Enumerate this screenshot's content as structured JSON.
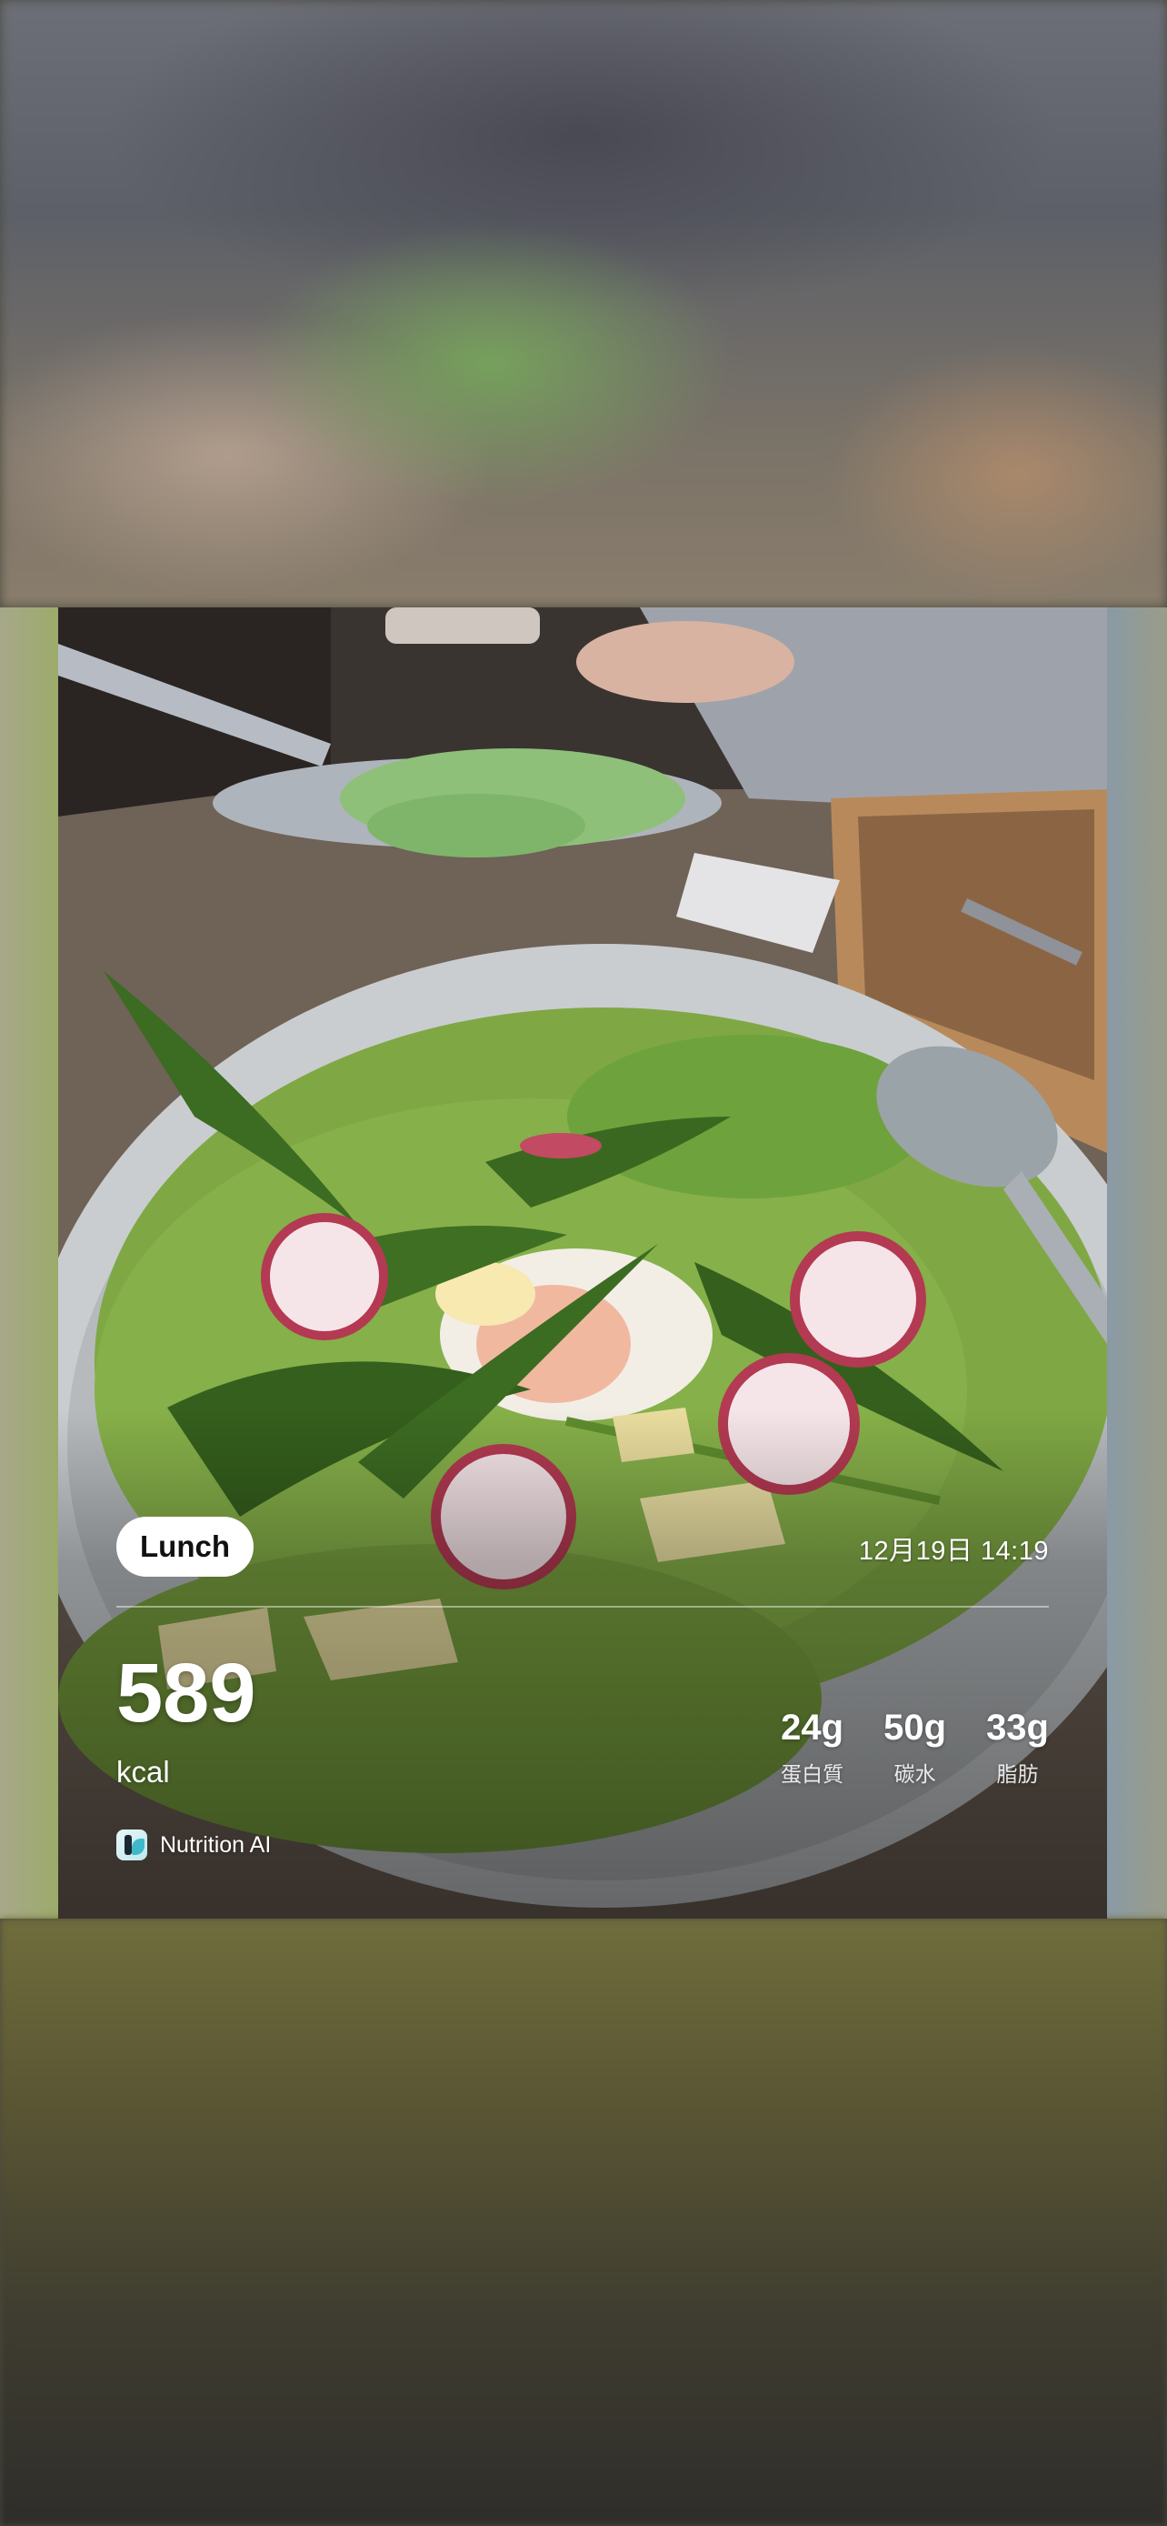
{
  "card": {
    "meal_label": "Lunch",
    "timestamp": "12月19日 14:19",
    "calories": {
      "value": "589",
      "unit": "kcal"
    },
    "macros": [
      {
        "value": "24g",
        "label": "蛋白質"
      },
      {
        "value": "50g",
        "label": "碳水"
      },
      {
        "value": "33g",
        "label": "脂肪"
      }
    ],
    "brand": {
      "name": "Nutrition AI",
      "icon": "nutrition-ai-logo-icon"
    }
  },
  "colors": {
    "pill_bg": "#ffffff",
    "text_on_photo": "#ffffff",
    "brand_icon_accent": "#3fb9c9"
  }
}
